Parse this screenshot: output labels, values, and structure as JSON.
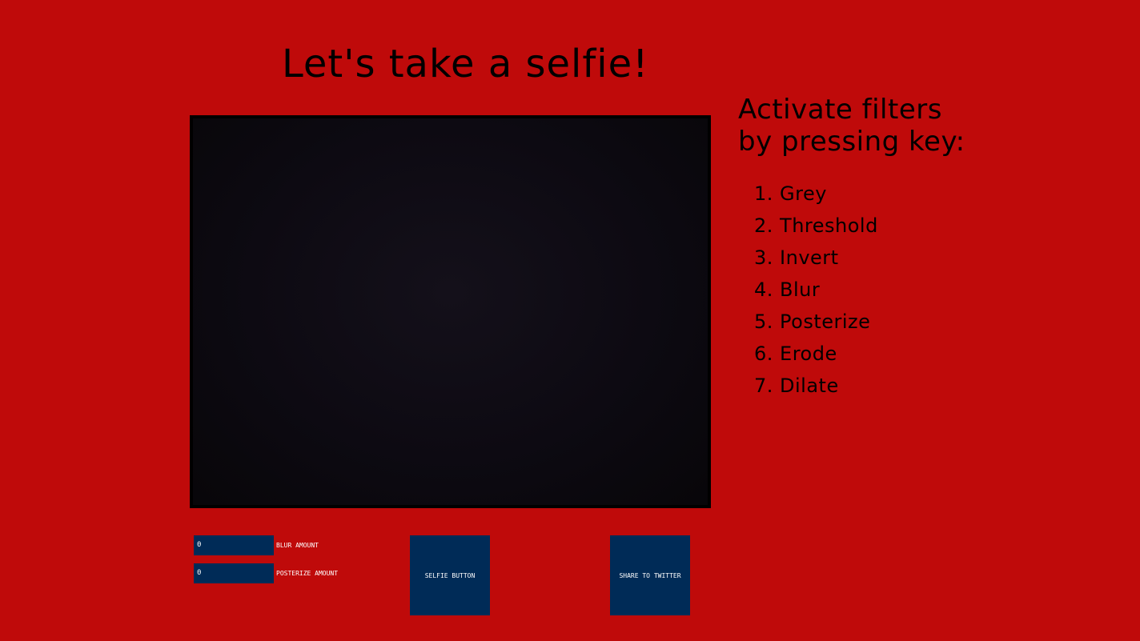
{
  "title": "Let's take a selfie!",
  "filters": {
    "heading_line1": "Activate filters",
    "heading_line2": "by pressing key:",
    "items": [
      {
        "label": "1. Grey"
      },
      {
        "label": "2. Threshold"
      },
      {
        "label": "3. Invert"
      },
      {
        "label": "4. Blur"
      },
      {
        "label": "5. Posterize"
      },
      {
        "label": "6. Erode"
      },
      {
        "label": "7. Dilate"
      }
    ]
  },
  "controls": {
    "blur": {
      "value": "0",
      "label": "BLUR AMOUNT"
    },
    "posterize": {
      "value": "0",
      "label": "POSTERIZE AMOUNT"
    },
    "selfie_button": "SELFIE BUTTON",
    "share_button": "SHARE TO TWITTER"
  },
  "colors": {
    "background": "#bf0a0a",
    "control": "#002b57",
    "video": "#0d0a12"
  }
}
